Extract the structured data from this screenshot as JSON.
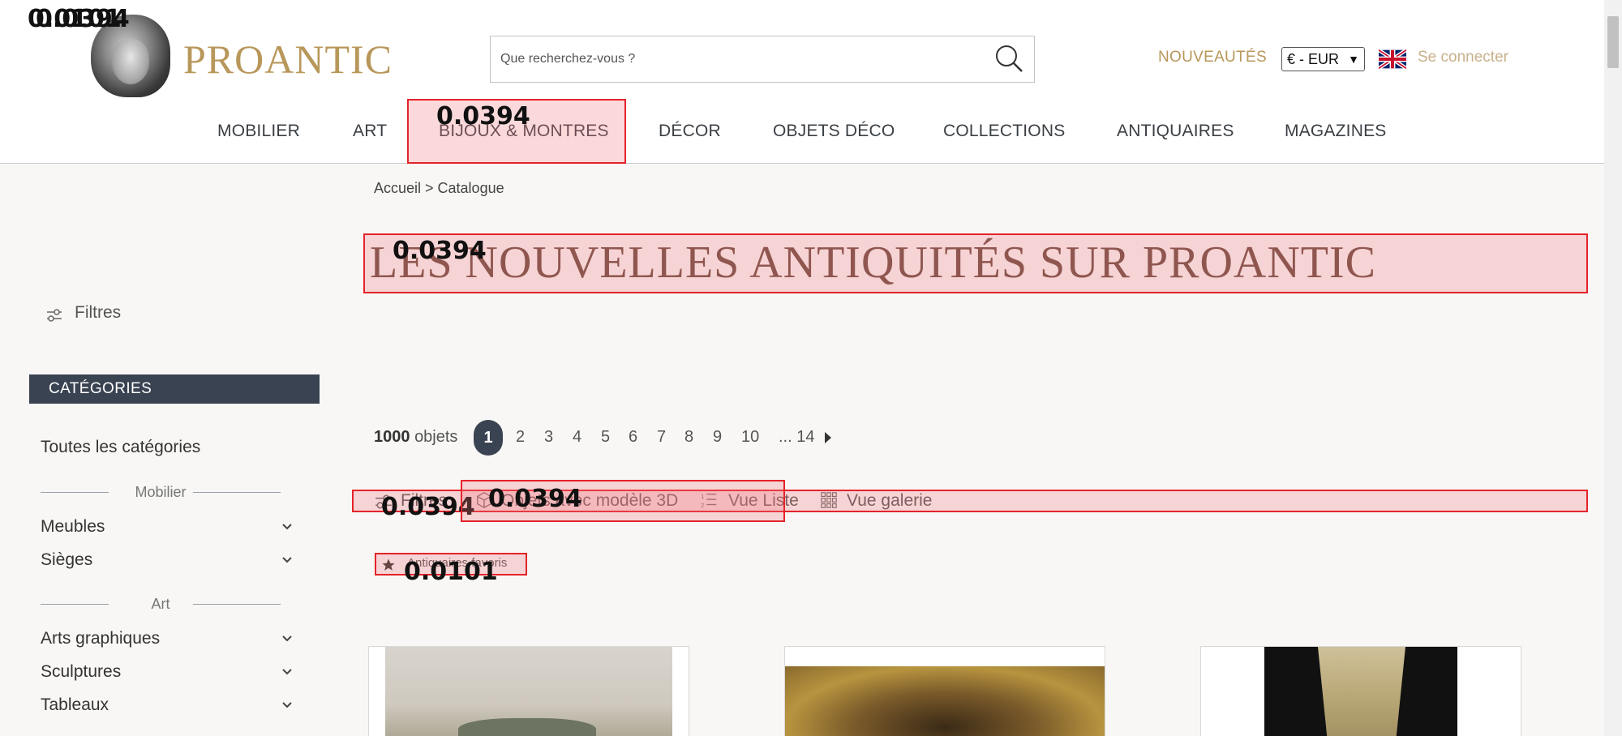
{
  "overlay_numbers": {
    "top_left_a": "0.0101",
    "top_left_b": "0.0394",
    "nav_bijoux": "0.0394",
    "title": "0.0394",
    "toolbar": "0.0394",
    "objets3d": "0.0394",
    "favoris": "0.0101"
  },
  "header": {
    "logo_text": "PROANTIC",
    "search_placeholder": "Que recherchez-vous ?",
    "nouveautes": "NOUVEAUTÉS",
    "currency": "€ - EUR",
    "login": "Se connecter"
  },
  "nav": [
    "MOBILIER",
    "ART",
    "BIJOUX & MONTRES",
    "DÉCOR",
    "OBJETS DÉCO",
    "COLLECTIONS",
    "ANTIQUAIRES",
    "MAGAZINES"
  ],
  "breadcrumb": "Accueil > Catalogue",
  "title": "LES NOUVELLES ANTIQUITÉS SUR PROANTIC",
  "sidebar": {
    "filtres": "Filtres",
    "categories_header": "CATÉGORIES",
    "all": "Toutes les catégories",
    "sep_mobilier": "Mobilier",
    "meubles": "Meubles",
    "sieges": "Sièges",
    "sep_art": "Art",
    "arts_graphiques": "Arts graphiques",
    "sculptures": "Sculptures",
    "tableaux": "Tableaux"
  },
  "pagination": {
    "count": "1000",
    "count_label": "objets",
    "active": "1",
    "pages": [
      "2",
      "3",
      "4",
      "5",
      "6",
      "7",
      "8",
      "9",
      "10"
    ],
    "last": "... 14"
  },
  "toolbar": {
    "filtres": "Filtres",
    "objets3d": "Objets avec modèle 3D",
    "vue_liste": "Vue Liste",
    "vue_galerie": "Vue galerie"
  },
  "favoris": "Antiquaires favoris"
}
